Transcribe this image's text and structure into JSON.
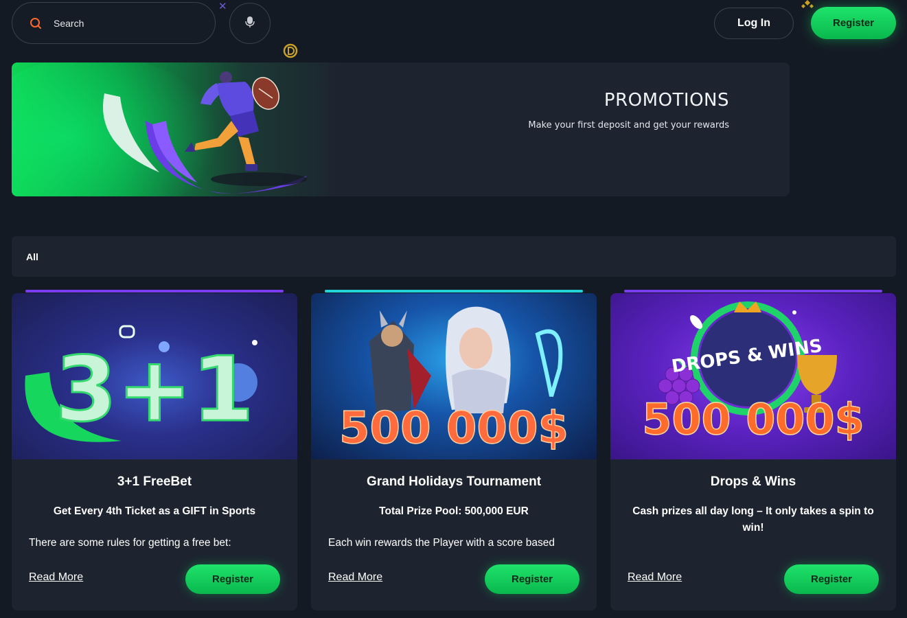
{
  "header": {
    "search_placeholder": "Search",
    "login_label": "Log In",
    "register_label": "Register"
  },
  "banner": {
    "title": "PROMOTIONS",
    "subtitle": "Make your first deposit and get your rewards"
  },
  "filters": {
    "tabs": [
      {
        "label": "All"
      }
    ]
  },
  "cards": [
    {
      "image_text": "3+1",
      "title": "3+1 FreeBet",
      "subtitle": "Get Every 4th Ticket as a GIFT in Sports",
      "description": "There are some rules for getting a free bet:",
      "read_more": "Read More",
      "register": "Register",
      "accent": "#7a3cf0"
    },
    {
      "image_text": "500 000$",
      "title": "Grand Holidays Tournament",
      "subtitle": "Total Prize Pool: 500,000 EUR",
      "description": "Each win rewards the Player with a score based",
      "read_more": "Read More",
      "register": "Register",
      "accent": "#22d3d8"
    },
    {
      "image_text_logo": "DROPS & WINS",
      "image_text": "500 000$",
      "title": "Drops & Wins",
      "subtitle": "Cash prizes all day long – It only takes a spin to win!",
      "description": "",
      "read_more": "Read More",
      "register": "Register",
      "accent": "#7a3cf0"
    }
  ],
  "colors": {
    "background": "#141a24",
    "panel": "#1d2430",
    "accent_green": "#14d65e"
  }
}
